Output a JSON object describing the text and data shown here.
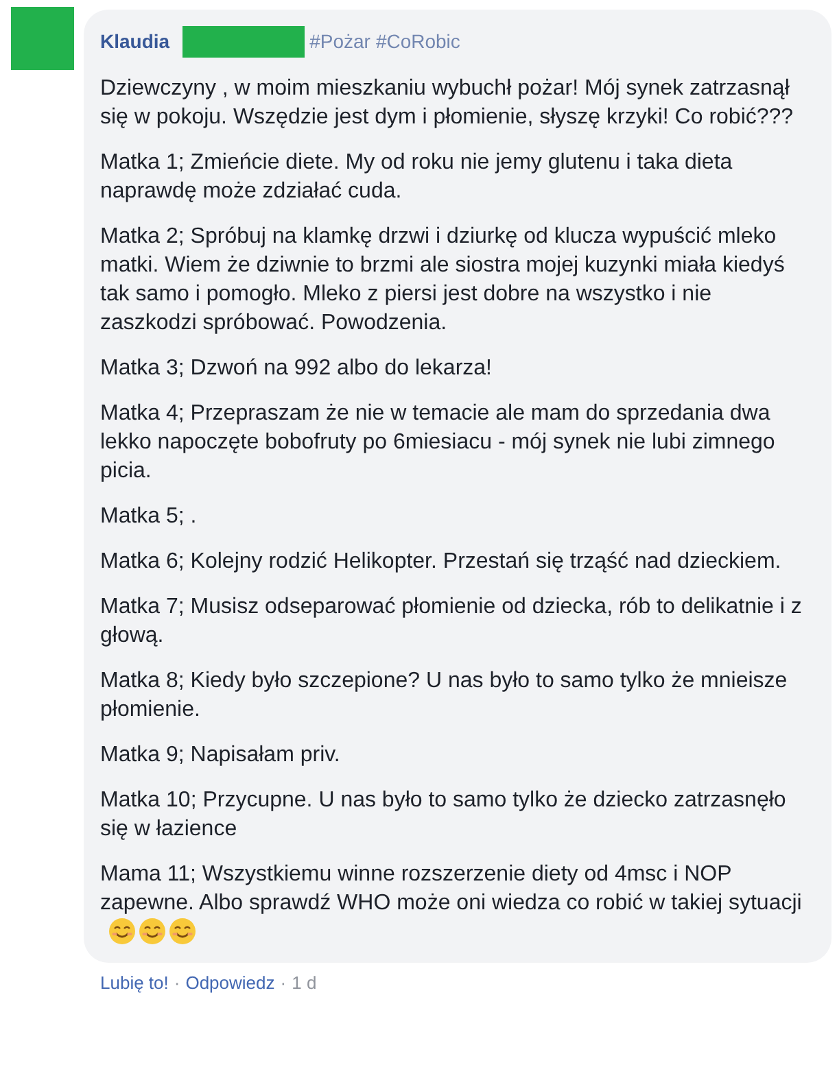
{
  "comment": {
    "author": "Klaudia",
    "author_redacted": true,
    "hashtags": [
      "#Pożar",
      "#CoRobic"
    ],
    "paragraphs": [
      {
        "text": "Dziewczyny , w moim mieszkaniu wybuchł pożar! Mój synek zatrzasnął się w pokoju. Wszędzie jest dym i płomienie, słyszę krzyki! Co robić???"
      },
      {
        "text": "Matka 1; Zmieńcie diete. My od roku nie jemy glutenu i taka dieta naprawdę może zdziałać cuda."
      },
      {
        "text": "Matka 2; Spróbuj na klamkę drzwi i dziurkę od klucza wypuścić mleko matki. Wiem że dziwnie to brzmi ale siostra mojej kuzynki miała kiedyś tak samo i pomogło. Mleko z piersi jest dobre na wszystko i nie zaszkodzi spróbować. Powodzenia."
      },
      {
        "text": "Matka 3; Dzwoń na 992 albo do lekarza!"
      },
      {
        "text": "Matka 4; Przepraszam że nie w temacie ale mam do sprzedania dwa lekko napoczęte bobofruty po 6miesiacu - mój synek nie lubi zimnego picia."
      },
      {
        "text": "Matka 5; ."
      },
      {
        "text": "Matka 6; Kolejny rodzić Helikopter. Przestań się trząść nad dzieckiem."
      },
      {
        "text": "Matka 7; Musisz odseparować płomienie od dziecka, rób to delikatnie i z głową."
      },
      {
        "text": "Matka 8; Kiedy było szczepione? U nas było to samo tylko że mnieisze płomienie."
      },
      {
        "text": "Matka 9; Napisałam priv."
      },
      {
        "text": "Matka 10; Przycupne. U nas było to samo tylko że dziecko zatrzasnęło się w łazience"
      },
      {
        "text": "Mama 11; Wszystkiemu winne rozszerzenie diety od 4msc i NOP zapewne. Albo sprawdź WHO może oni wiedza co robić w takiej sytuacji",
        "trailing_icons": [
          {
            "kind": "smiling-face"
          },
          {
            "kind": "smiling-face"
          },
          {
            "kind": "smiling-face"
          }
        ]
      }
    ],
    "actions": [
      "Lubię to!",
      "Odpowiedz"
    ],
    "separator": "·",
    "time": "1 d"
  }
}
